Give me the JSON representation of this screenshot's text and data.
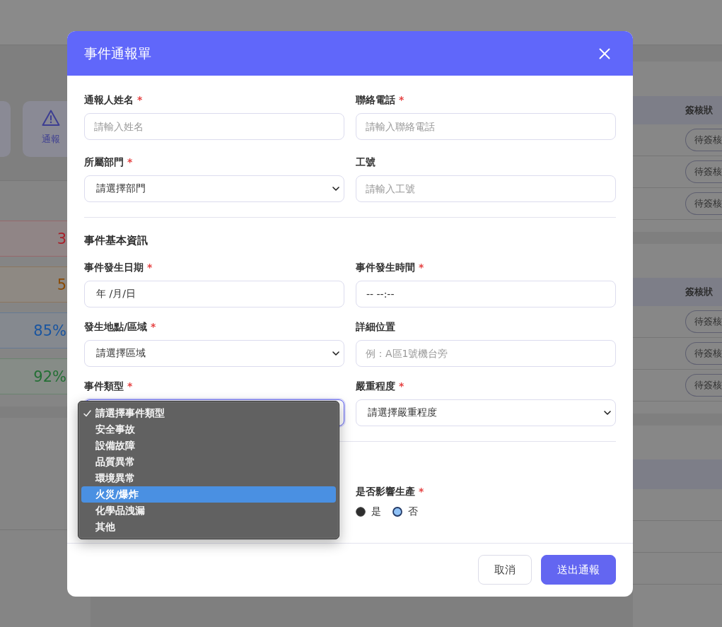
{
  "background": {
    "shortcut": {
      "label": "通報"
    },
    "stat_cards": [
      {
        "value": "3",
        "color": "#a8202a"
      },
      {
        "value": "5",
        "color": "#8a4a04"
      },
      {
        "value": "85%",
        "color": "#1a55a0"
      },
      {
        "value": "92%",
        "color": "#246f35"
      }
    ],
    "approval_tables": [
      {
        "header": "簽核狀",
        "rows": [
          {
            "status": "待簽核"
          },
          {
            "status": "待簽核"
          },
          {
            "status": "待簽核"
          }
        ]
      },
      {
        "header": "簽核狀",
        "rows": [
          {
            "status": "待簽核"
          },
          {
            "status": "待簽核"
          },
          {
            "status": "待簽核"
          }
        ]
      }
    ]
  },
  "modal": {
    "title": "事件通報單",
    "sections": [
      {
        "fields": [
          {
            "kind": "text",
            "label": "通報人姓名",
            "required_mark": "*",
            "placeholder": "請輸入姓名",
            "focused": false
          },
          {
            "kind": "text",
            "label": "聯絡電話",
            "required_mark": "*",
            "placeholder": "請輸入聯絡電話",
            "focused": false
          },
          {
            "kind": "select",
            "label": "所屬部門",
            "required_mark": "*",
            "value": "請選擇部門",
            "focused": false,
            "open": false
          },
          {
            "kind": "text",
            "label": "工號",
            "placeholder": "請輸入工號",
            "focused": false
          }
        ]
      },
      {
        "title": "事件基本資訊",
        "fields": [
          {
            "kind": "date",
            "label": "事件發生日期",
            "required_mark": "*",
            "value": "年 /月/日",
            "focused": false
          },
          {
            "kind": "time",
            "label": "事件發生時間",
            "required_mark": "*",
            "value": "-- --:--",
            "focused": false
          },
          {
            "kind": "select",
            "label": "發生地點/區域",
            "required_mark": "*",
            "value": "請選擇區域",
            "focused": false,
            "open": false
          },
          {
            "kind": "text",
            "label": "詳細位置",
            "placeholder": "例：A區1號機台旁",
            "focused": false
          },
          {
            "kind": "select",
            "label": "事件類型",
            "required_mark": "*",
            "focused": true,
            "open": true,
            "options": [
              {
                "label": "請選擇事件類型",
                "selected": true,
                "highlighted": false
              },
              {
                "label": "安全事故",
                "selected": false,
                "highlighted": false
              },
              {
                "label": "設備故障",
                "selected": false,
                "highlighted": false
              },
              {
                "label": "品質異常",
                "selected": false,
                "highlighted": false
              },
              {
                "label": "環境異常",
                "selected": false,
                "highlighted": false
              },
              {
                "label": "火災/爆炸",
                "selected": false,
                "highlighted": true
              },
              {
                "label": "化學品洩漏",
                "selected": false,
                "highlighted": false
              },
              {
                "label": "其他",
                "selected": false,
                "highlighted": false
              }
            ]
          },
          {
            "kind": "select",
            "label": "嚴重程度",
            "required_mark": "*",
            "value": "請選擇嚴重程度",
            "focused": false,
            "open": false
          }
        ]
      },
      {
        "fields": [
          {
            "kind": "radio",
            "label": "是否影響生產",
            "required_mark": "*",
            "options": [
              {
                "label": "是",
                "selected": false
              },
              {
                "label": "否",
                "selected": true
              }
            ]
          }
        ]
      }
    ],
    "buttons": [
      {
        "label": "取消",
        "kind": "secondary"
      },
      {
        "label": "送出通報",
        "kind": "primary"
      }
    ]
  }
}
